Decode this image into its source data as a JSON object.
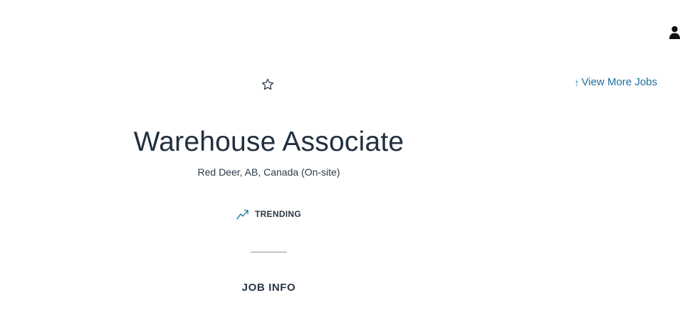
{
  "header": {
    "user_icon": "user-icon"
  },
  "nav": {
    "view_more_arrow": "↑",
    "view_more_label": "View More Jobs"
  },
  "job": {
    "favorite_icon": "star-outline-icon",
    "title": "Warehouse Associate",
    "location": "Red Deer, AB, Canada (On-site)",
    "trending_icon": "trending-up-icon",
    "trending_label": "TRENDING"
  },
  "sections": {
    "job_info_heading": "JOB INFO"
  },
  "colors": {
    "link": "#1b6f9e",
    "text": "#22303f",
    "divider": "#8b8f94"
  }
}
